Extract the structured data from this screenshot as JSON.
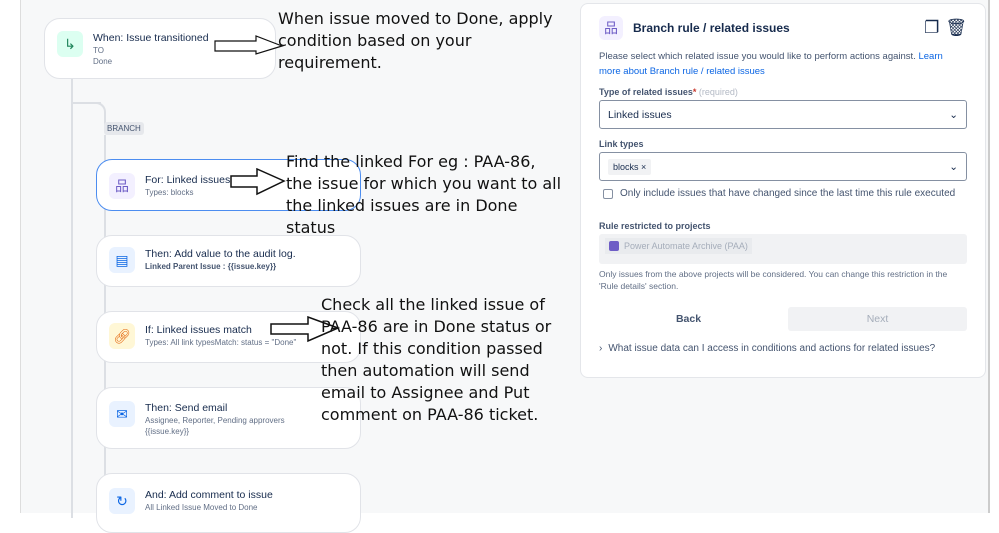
{
  "flow": {
    "trigger": {
      "title": "When: Issue transitioned",
      "line1": "TO",
      "line2": "Done"
    },
    "branch_badge": "BRANCH",
    "branch": {
      "title": "For: Linked issues",
      "sub": "Types: blocks"
    },
    "audit": {
      "title": "Then: Add value to the audit log.",
      "sub": "Linked Parent Issue : {{issue.key}}"
    },
    "condition": {
      "title": "If: Linked issues match",
      "sub": "Types: All link typesMatch: status = \"Done\""
    },
    "email": {
      "title": "Then: Send email",
      "sub1": "Assignee, Reporter, Pending approvers",
      "sub2": "{{issue.key}}"
    },
    "comment": {
      "title": "And: Add comment to issue",
      "sub": "All Linked Issue Moved to Done"
    }
  },
  "annotations": {
    "a1": "When issue moved to Done, apply condition based on your requirement.",
    "a2": "Find the linked For eg : PAA-86, the issue for which you want to all the linked issues are in Done status",
    "a3": "Check all the linked issue of PAA-86 are in Done status or not. If this condition passed then automation will send email to Assignee and Put comment on PAA-86 ticket."
  },
  "panel": {
    "title": "Branch rule / related issues",
    "desc": "Please select which related issue you would like to perform actions against.",
    "learn_link": "Learn more about Branch rule / related issues",
    "type_label": "Type of related issues",
    "required_mark": "*",
    "required_text": "(required)",
    "type_value": "Linked issues",
    "link_types_label": "Link types",
    "link_tag": "blocks",
    "checkbox_label": "Only include issues that have changed since the last time this rule executed",
    "projects_label": "Rule restricted to projects",
    "project": "Power Automate Archive (PAA)",
    "projects_help": "Only issues from the above projects will be considered. You can change this restriction in the 'Rule details' section.",
    "back": "Back",
    "next": "Next",
    "faq": "What issue data can I access in conditions and actions for related issues?"
  }
}
